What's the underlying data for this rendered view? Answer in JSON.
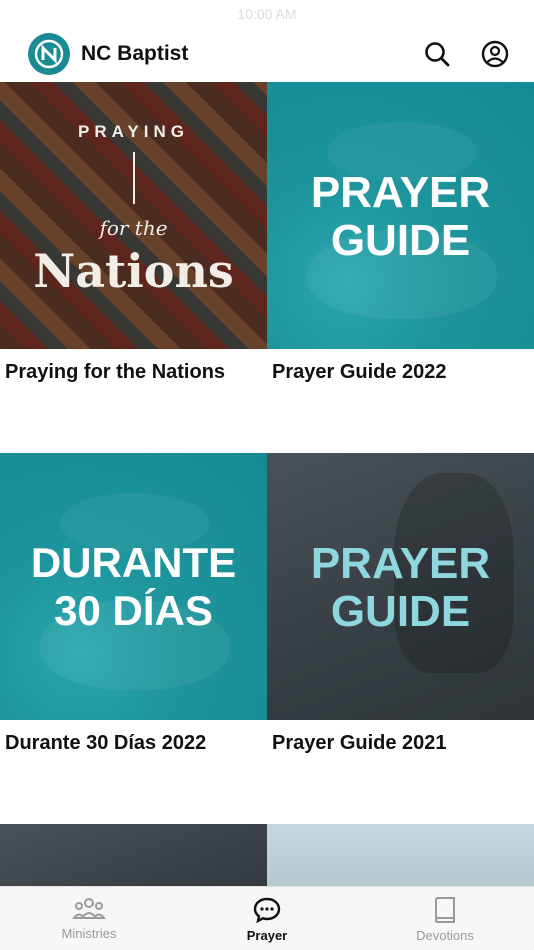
{
  "status_bar": {
    "time": "10:00 AM"
  },
  "header": {
    "app_name": "NC Baptist"
  },
  "cards": [
    {
      "title": "Praying for the Nations",
      "art_top": "PRAYING",
      "art_mid": "for the",
      "art_big": "Nations"
    },
    {
      "title": "Prayer Guide 2022",
      "art_line1": "PRAYER",
      "art_line2": "GUIDE"
    },
    {
      "title": "Durante 30 Días 2022",
      "art_line1": "DURANTE",
      "art_line2": "30 DÍAS"
    },
    {
      "title": "Prayer Guide 2021",
      "art_line1": "PRAYER",
      "art_line2": "GUIDE"
    }
  ],
  "tabs": [
    {
      "label": "Ministries",
      "icon": "people-icon",
      "active": false
    },
    {
      "label": "Prayer",
      "icon": "chat-bubble-icon",
      "active": true
    },
    {
      "label": "Devotions",
      "icon": "book-icon",
      "active": false
    }
  ],
  "colors": {
    "brand": "#1a8b94",
    "teal_tile": "#1d939b",
    "guide_2021_text": "#8fd7df"
  }
}
